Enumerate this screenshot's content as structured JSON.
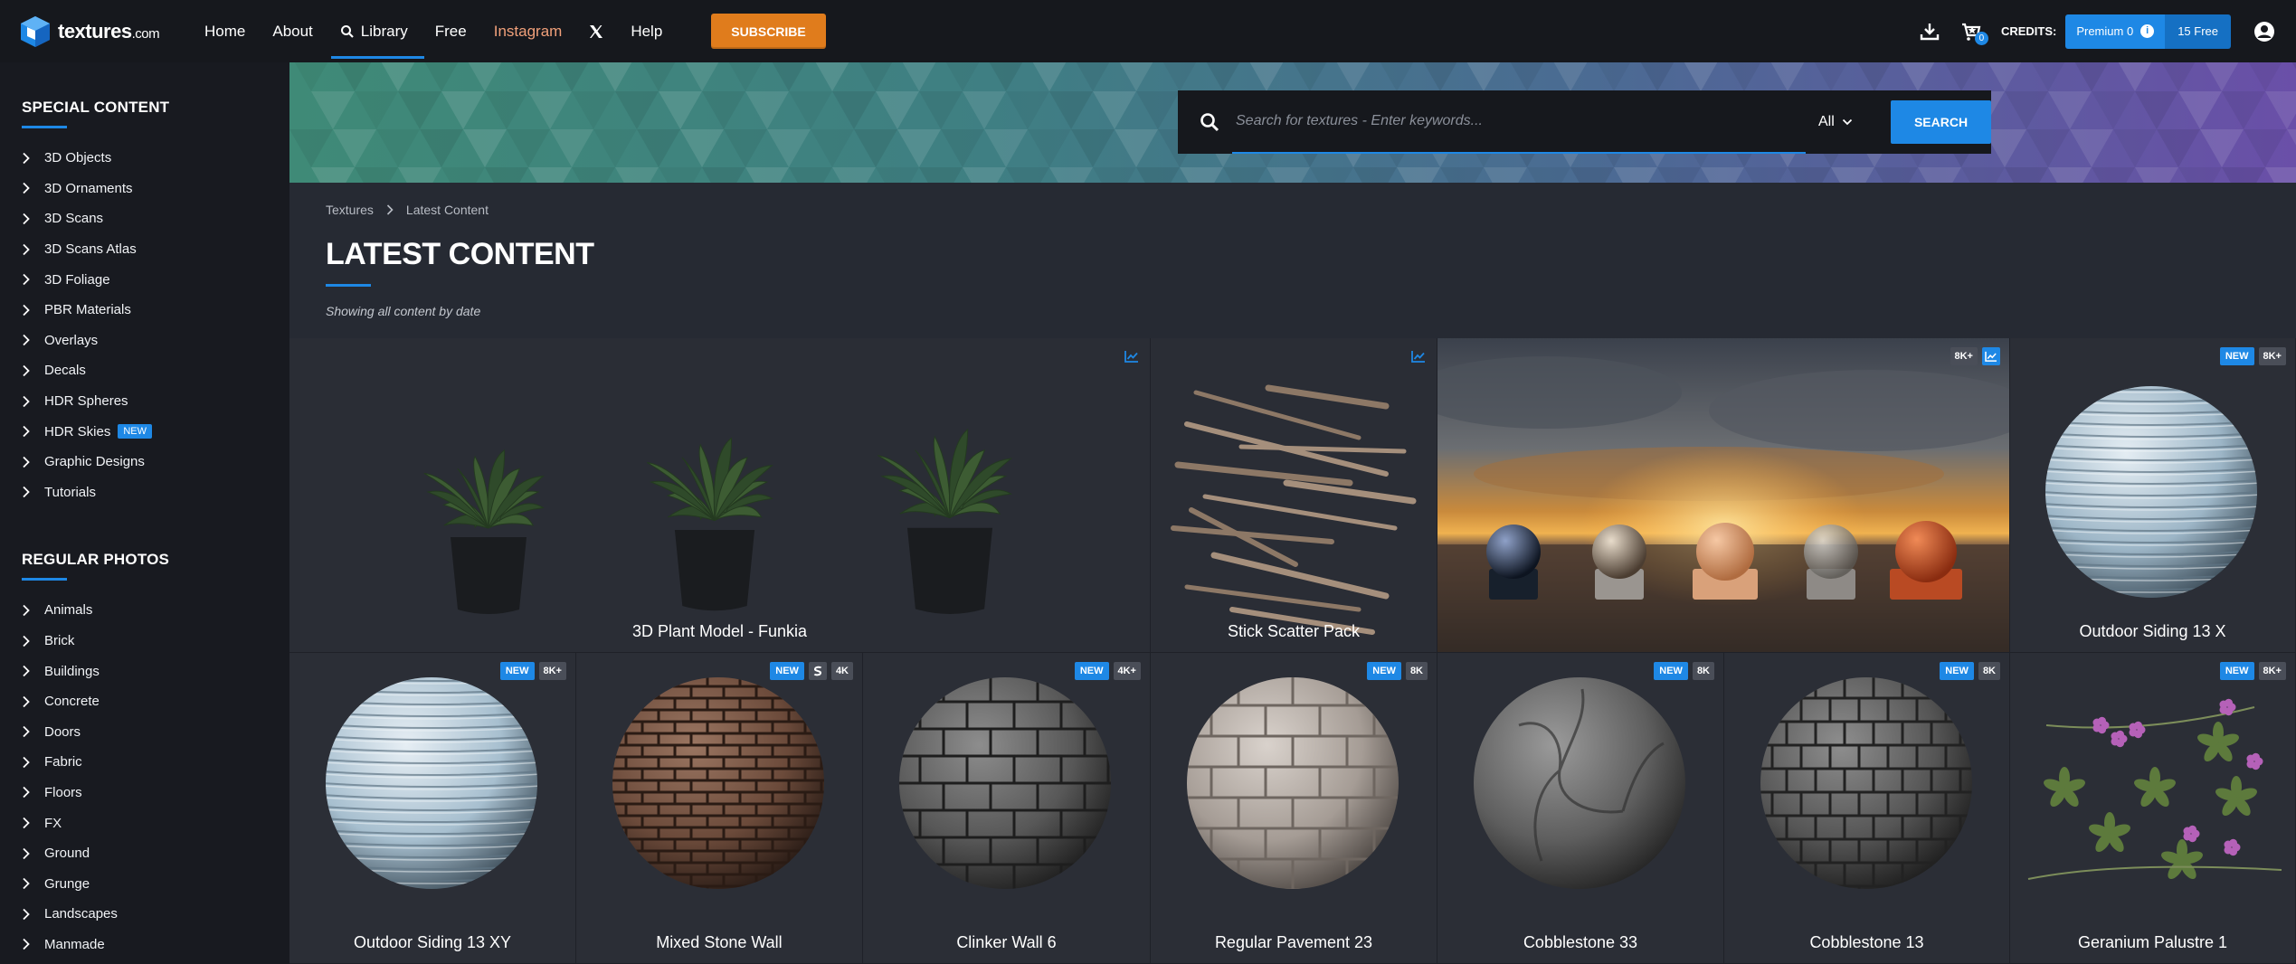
{
  "header": {
    "logo_text": "textures",
    "logo_suffix": ".com",
    "nav": [
      {
        "label": "Home"
      },
      {
        "label": "About"
      },
      {
        "label": "Library"
      },
      {
        "label": "Free"
      },
      {
        "label": "Instagram"
      },
      {
        "label": "Help"
      }
    ],
    "subscribe_label": "SUBSCRIBE",
    "cart_count": "0",
    "credits_label": "CREDITS:",
    "premium_label": "Premium 0",
    "free_label": "15 Free"
  },
  "sidebar": {
    "special_title": "SPECIAL CONTENT",
    "special_items": [
      {
        "label": "3D Objects"
      },
      {
        "label": "3D Ornaments"
      },
      {
        "label": "3D Scans"
      },
      {
        "label": "3D Scans Atlas"
      },
      {
        "label": "3D Foliage"
      },
      {
        "label": "PBR Materials"
      },
      {
        "label": "Overlays"
      },
      {
        "label": "Decals"
      },
      {
        "label": "HDR Spheres"
      },
      {
        "label": "HDR Skies",
        "badge": "NEW"
      },
      {
        "label": "Graphic Designs"
      },
      {
        "label": "Tutorials"
      }
    ],
    "regular_title": "REGULAR PHOTOS",
    "regular_items": [
      {
        "label": "Animals"
      },
      {
        "label": "Brick"
      },
      {
        "label": "Buildings"
      },
      {
        "label": "Concrete"
      },
      {
        "label": "Doors"
      },
      {
        "label": "Fabric"
      },
      {
        "label": "Floors"
      },
      {
        "label": "FX"
      },
      {
        "label": "Ground"
      },
      {
        "label": "Grunge"
      },
      {
        "label": "Landscapes"
      },
      {
        "label": "Manmade"
      }
    ]
  },
  "search": {
    "placeholder": "Search for textures - Enter keywords...",
    "category": "All",
    "button_label": "SEARCH"
  },
  "content": {
    "breadcrumb": [
      "Textures",
      "Latest Content"
    ],
    "title": "LATEST CONTENT",
    "subtitle": "Showing all content by date"
  },
  "tiles": [
    {
      "label": "3D Plant Model - Funkia",
      "badges": []
    },
    {
      "label": "Stick Scatter Pack",
      "badges": []
    },
    {
      "label": "",
      "badges": [
        "8K+"
      ]
    },
    {
      "label": "Outdoor Siding 13 X",
      "badges": [
        "NEW",
        "8K+"
      ]
    },
    {
      "label": "Outdoor Siding 13 XY",
      "badges": [
        "NEW",
        "8K+"
      ]
    },
    {
      "label": "Mixed Stone Wall",
      "badges": [
        "NEW",
        "4K"
      ]
    },
    {
      "label": "Clinker Wall 6",
      "badges": [
        "NEW",
        "4K+"
      ]
    },
    {
      "label": "Regular Pavement 23",
      "badges": [
        "NEW",
        "8K"
      ]
    },
    {
      "label": "Cobblestone 33",
      "badges": [
        "NEW",
        "8K"
      ]
    },
    {
      "label": "Cobblestone 13",
      "badges": [
        "NEW",
        "8K"
      ]
    },
    {
      "label": "Geranium Palustre 1",
      "badges": [
        "NEW",
        "8K+"
      ]
    }
  ],
  "colors": {
    "accent": "#1e88e5",
    "subscribe": "#e07c1c",
    "instagram": "#f1a07a",
    "background": "#262a33",
    "sidebar": "#181a20",
    "topbar": "#16181d"
  }
}
